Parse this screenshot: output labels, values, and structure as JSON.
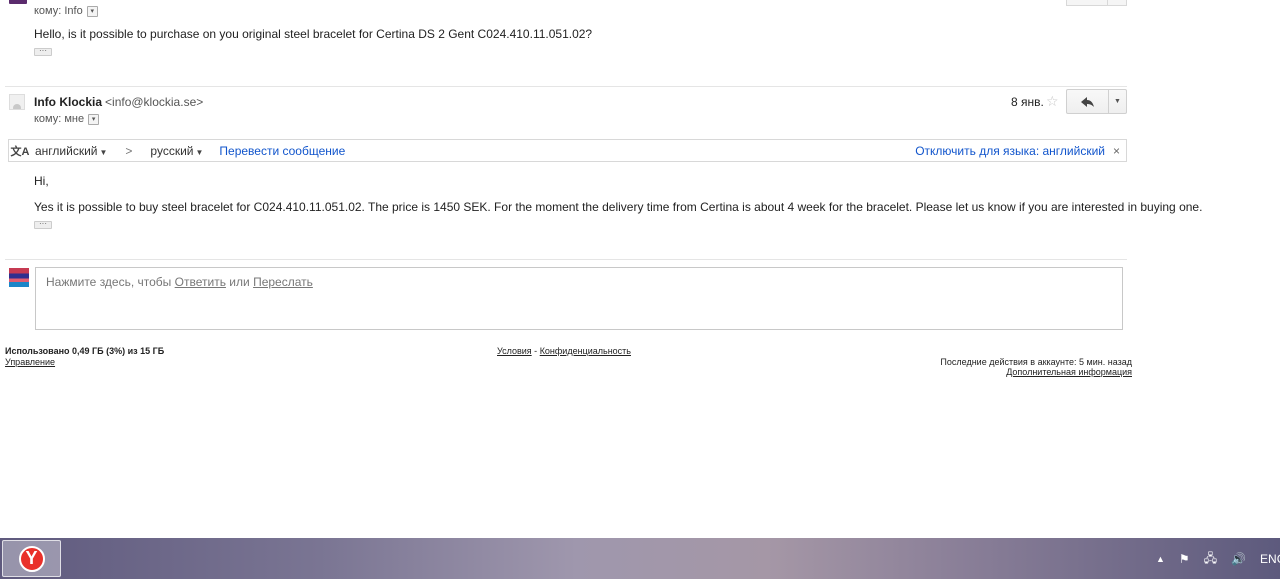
{
  "message1": {
    "to_label": "кому: Info",
    "body": "Hello, is it possible to purchase on you original steel bracelet for Certina DS 2 Gent C024.410.11.051.02?"
  },
  "message2": {
    "sender_name": "Info Klockia",
    "sender_email": "<info@klockia.se>",
    "to_label": "кому: мне",
    "date": "8 янв.",
    "greeting": "Hi,",
    "body": "Yes it is possible to buy steel bracelet for C024.410.11.051.02. The price is 1450 SEK. For the moment the delivery time from Certina is about 4 week for the bracelet. Please let us know if you are interested in buying one."
  },
  "translate_bar": {
    "source_lang": "английский",
    "target_lang": "русский",
    "translate_link": "Перевести сообщение",
    "disable_link": "Отключить для языка: английский",
    "close": "×",
    "arrow": ">"
  },
  "reply_box": {
    "prefix": "Нажмите здесь, чтобы",
    "reply_link": "Ответить",
    "or": "или",
    "forward_link": "Переслать"
  },
  "footer": {
    "storage": "Использовано 0,49 ГБ (3%) из 15 ГБ",
    "manage": "Управление",
    "terms": "Условия",
    "separator": "-",
    "privacy": "Конфиденциальность",
    "last_activity": "Последние действия в аккаунте: 5 мин. назад",
    "details": "Дополнительная информация"
  },
  "taskbar": {
    "language": "ENG"
  },
  "colors": {
    "link_blue": "#1155cc",
    "taskbar": "#7a7593"
  }
}
